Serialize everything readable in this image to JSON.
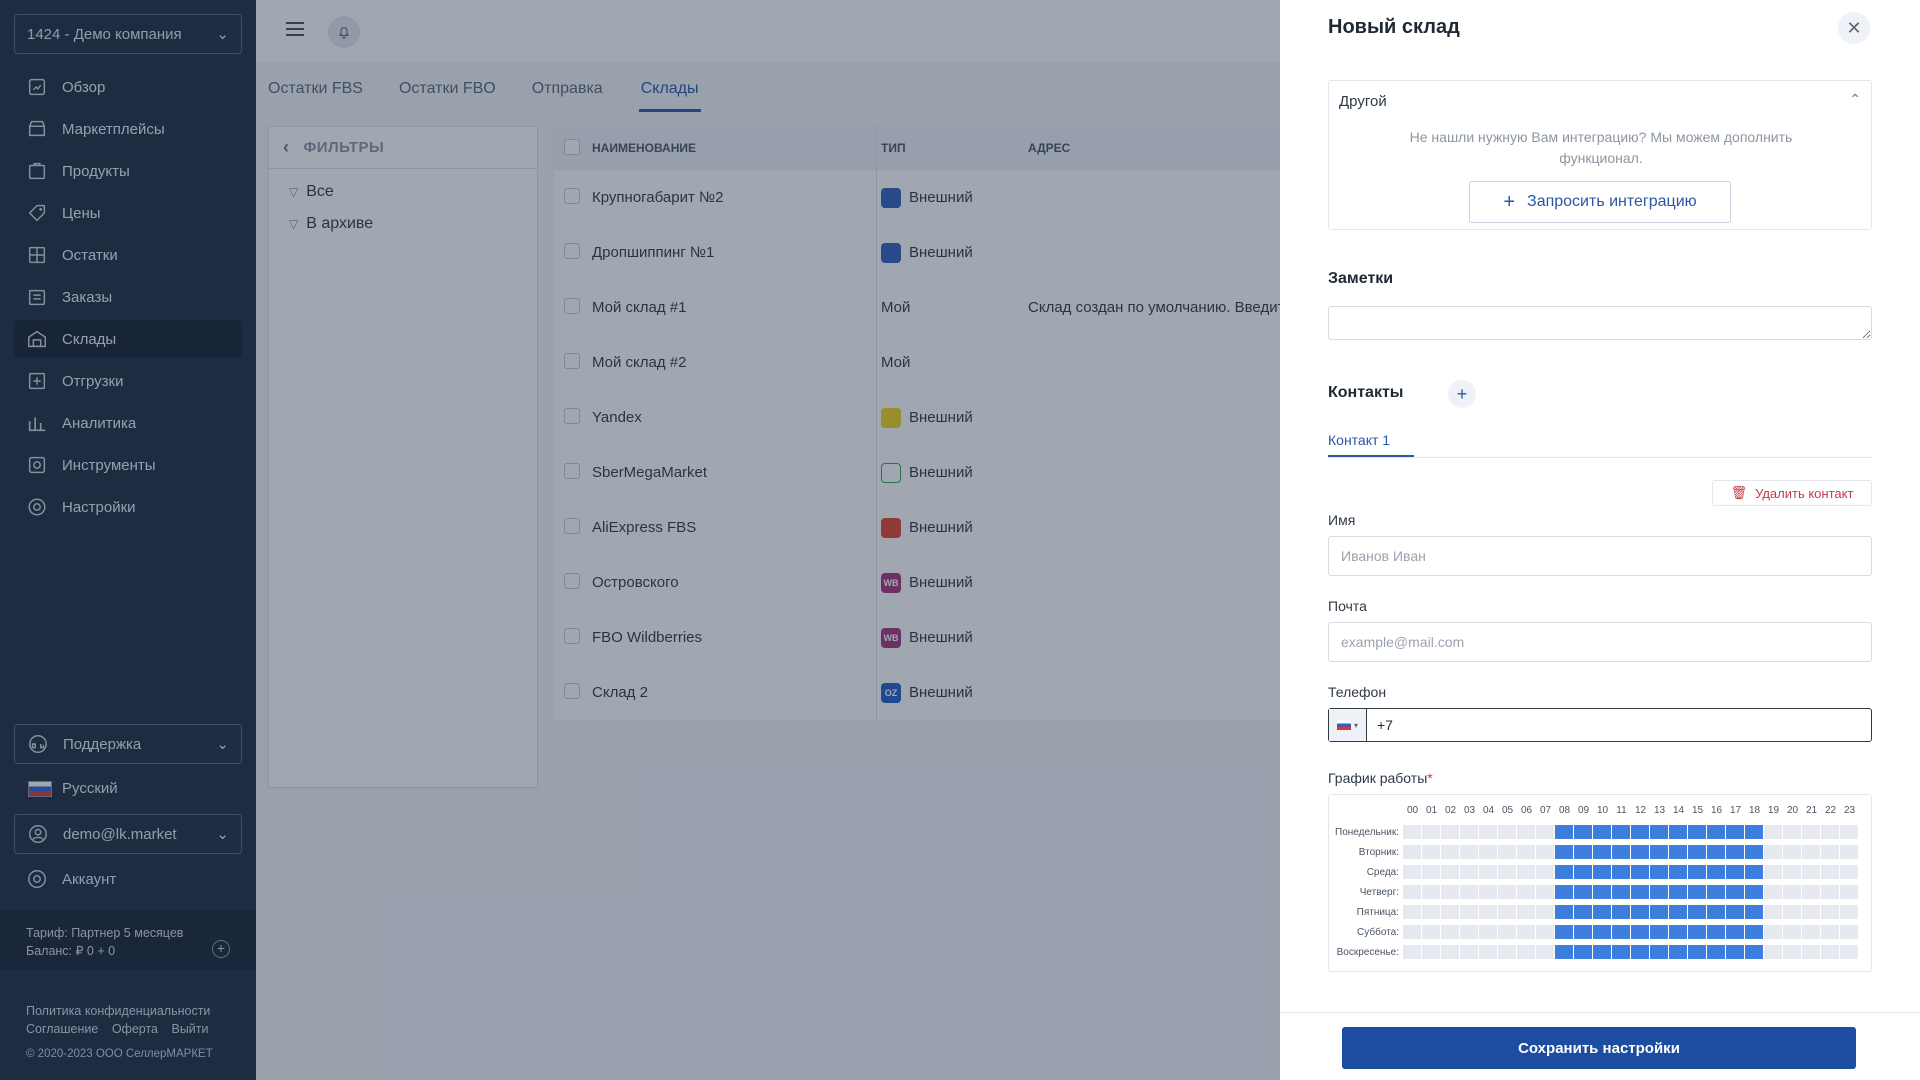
{
  "sidebar": {
    "company": "1424 - Демо компания",
    "nav": [
      {
        "label": "Обзор",
        "icon": "overview-icon",
        "active": false
      },
      {
        "label": "Маркетплейсы",
        "icon": "marketplaces-icon",
        "active": false
      },
      {
        "label": "Продукты",
        "icon": "products-icon",
        "active": false
      },
      {
        "label": "Цены",
        "icon": "prices-icon",
        "active": false
      },
      {
        "label": "Остатки",
        "icon": "stock-icon",
        "active": false
      },
      {
        "label": "Заказы",
        "icon": "orders-icon",
        "active": false
      },
      {
        "label": "Склады",
        "icon": "warehouse-icon",
        "active": true
      },
      {
        "label": "Отгрузки",
        "icon": "shipments-icon",
        "active": false
      },
      {
        "label": "Аналитика",
        "icon": "analytics-icon",
        "active": false
      },
      {
        "label": "Инструменты",
        "icon": "tools-icon",
        "active": false
      },
      {
        "label": "Настройки",
        "icon": "settings-icon",
        "active": false
      }
    ],
    "support": "Поддержка",
    "language": "Русский",
    "user": "demo@lk.market",
    "account": "Аккаунт",
    "tariff": "Тариф: Партнер 5 месяцев",
    "balance": "Баланс: ₽ 0 + 0",
    "links": [
      "Политика конфиденциальности",
      "Соглашение",
      "Оферта",
      "Выйти"
    ],
    "copyright": "© 2020-2023 ООО СеллерМАРКЕТ"
  },
  "main": {
    "tabs": [
      {
        "label": "Остатки FBS",
        "active": false
      },
      {
        "label": "Остатки FBO",
        "active": false
      },
      {
        "label": "Отправка",
        "active": false
      },
      {
        "label": "Склады",
        "active": true
      }
    ],
    "filters": {
      "title": "ФИЛЬТРЫ",
      "items": [
        "Все",
        "В архиве"
      ]
    },
    "table": {
      "headers": {
        "name": "НАИМЕНОВАНИЕ",
        "type": "ТИП",
        "address": "АДРЕС"
      },
      "rows": [
        {
          "name": "Крупногабарит №2",
          "type": "Внешний",
          "badge": "ozon",
          "badge_color": "#2f5fb8",
          "address": ""
        },
        {
          "name": "Дропшиппинг №1",
          "type": "Внешний",
          "badge": "ozon",
          "badge_color": "#2f5fb8",
          "address": ""
        },
        {
          "name": "Мой склад #1",
          "type": "Мой",
          "badge": "",
          "badge_color": "",
          "address": "Склад создан по умолчанию. Введите адр"
        },
        {
          "name": "Мой склад #2",
          "type": "Мой",
          "badge": "",
          "badge_color": "",
          "address": ""
        },
        {
          "name": "Yandex",
          "type": "Внешний",
          "badge": "yandex",
          "badge_color": "#f2d31b",
          "address": ""
        },
        {
          "name": "SberMegaMarket",
          "type": "Внешний",
          "badge": "sber",
          "badge_color": "#ffffff",
          "address": ""
        },
        {
          "name": "AliExpress FBS",
          "type": "Внешний",
          "badge": "ali",
          "badge_color": "#e3452f",
          "address": ""
        },
        {
          "name": "Островского",
          "type": "Внешний",
          "badge": "WB",
          "badge_color": "#a4327d",
          "address": ""
        },
        {
          "name": "FBO Wildberries",
          "type": "Внешний",
          "badge": "WB",
          "badge_color": "#a4327d",
          "address": ""
        },
        {
          "name": "Склад 2",
          "type": "Внешний",
          "badge": "OZON",
          "badge_color": "#1f5ec7",
          "address": ""
        }
      ]
    }
  },
  "drawer": {
    "title": "Новый склад",
    "other": {
      "title": "Другой",
      "text": "Не нашли нужную Вам интеграцию? Мы можем дополнить функционал.",
      "button": "Запросить интеграцию"
    },
    "notes_title": "Заметки",
    "notes_value": "",
    "contacts_title": "Контакты",
    "contact_tab": "Контакт 1",
    "delete_contact": "Удалить контакт",
    "name_label": "Имя",
    "name_placeholder": "Иванов Иван",
    "email_label": "Почта",
    "email_placeholder": "example@mail.com",
    "phone_label": "Телефон",
    "phone_value": "+7",
    "schedule_label": "График работы",
    "schedule_required": "*",
    "hours": [
      "00",
      "01",
      "02",
      "03",
      "04",
      "05",
      "06",
      "07",
      "08",
      "09",
      "10",
      "11",
      "12",
      "13",
      "14",
      "15",
      "16",
      "17",
      "18",
      "19",
      "20",
      "21",
      "22",
      "23"
    ],
    "days": [
      "Понедельник:",
      "Вторник:",
      "Среда:",
      "Четверг:",
      "Пятница:",
      "Суббота:",
      "Воскресенье:"
    ],
    "work_hours": {
      "from": 8,
      "to": 18
    },
    "save": "Сохранить настройки"
  },
  "colors": {
    "accent": "#2c56a6",
    "schedule_on": "#3d7ede",
    "danger": "#c23b47",
    "sidebar_bg": "#1d2b3e"
  }
}
